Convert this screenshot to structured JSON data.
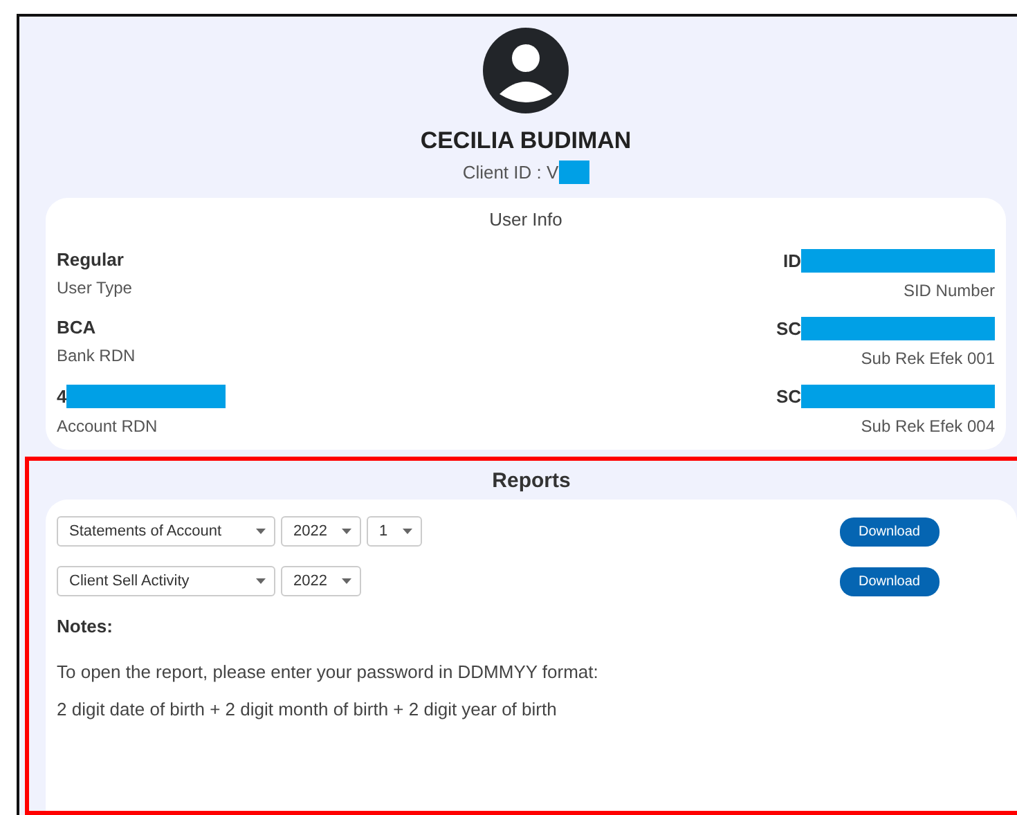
{
  "profile": {
    "name": "CECILIA BUDIMAN",
    "client_id_label": "Client ID : V",
    "client_id_redacted": true
  },
  "user_info": {
    "title": "User Info",
    "items": [
      {
        "value": "Regular",
        "label": "User Type",
        "redacted": false
      },
      {
        "value": "ID",
        "label": "SID Number",
        "redacted": true
      },
      {
        "value": "BCA",
        "label": "Bank RDN",
        "redacted": false
      },
      {
        "value": "SC",
        "label": "Sub Rek Efek 001",
        "redacted": true
      },
      {
        "value": "4",
        "label": "Account RDN",
        "redacted": true
      },
      {
        "value": "SC",
        "label": "Sub Rek Efek 004",
        "redacted": true
      }
    ]
  },
  "reports": {
    "title": "Reports",
    "highlighted": true,
    "rows": [
      {
        "dropdowns": [
          "Statements of Account",
          "2022",
          "1"
        ],
        "button": "Download"
      },
      {
        "dropdowns": [
          "Client Sell Activity",
          "2022"
        ],
        "button": "Download"
      }
    ],
    "notes_title": "Notes:",
    "notes": [
      "To open the report, please enter your password in DDMMYY format:",
      "2 digit date of birth + 2 digit month of birth + 2 digit year of birth"
    ]
  }
}
